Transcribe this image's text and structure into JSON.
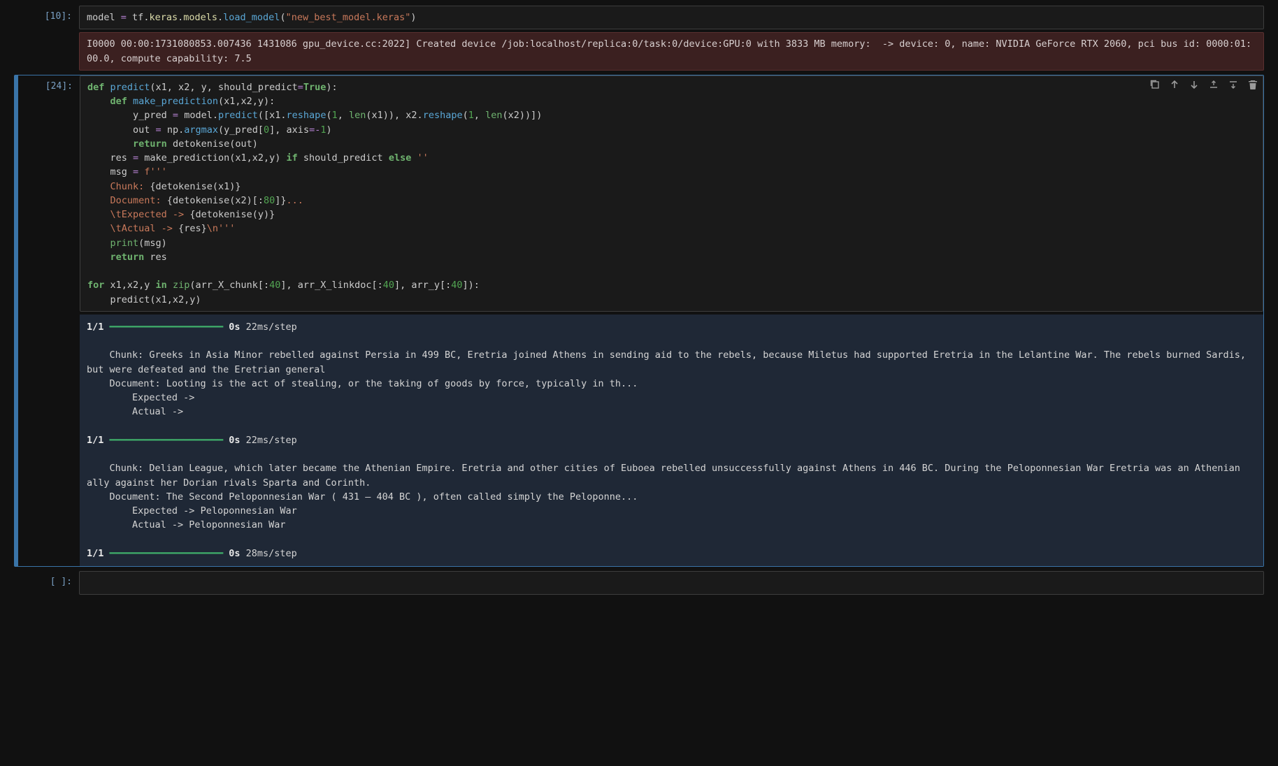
{
  "cells": {
    "c1": {
      "prompt": "[10]:",
      "code_tokens": [
        {
          "t": "model ",
          "c": "id"
        },
        {
          "t": "=",
          "c": "op"
        },
        {
          "t": " tf",
          "c": "id"
        },
        {
          "t": ".",
          "c": "c1"
        },
        {
          "t": "keras",
          "c": "nm"
        },
        {
          "t": ".",
          "c": "c1"
        },
        {
          "t": "models",
          "c": "nm"
        },
        {
          "t": ".",
          "c": "c1"
        },
        {
          "t": "load_model",
          "c": "fn"
        },
        {
          "t": "(",
          "c": "c1"
        },
        {
          "t": "\"new_best_model.keras\"",
          "c": "s"
        },
        {
          "t": ")",
          "c": "c1"
        }
      ],
      "stderr": "I0000 00:00:1731080853.007436 1431086 gpu_device.cc:2022] Created device /job:localhost/replica:0/task:0/device:GPU:0 with 3833 MB memory:  -> device: 0, name: NVIDIA GeForce RTX 2060, pci bus id: 0000:01:00.0, compute capability: 7.5"
    },
    "c2": {
      "prompt": "[24]:",
      "code_lines": [
        [
          {
            "t": "def ",
            "c": "k"
          },
          {
            "t": "predict",
            "c": "fn"
          },
          {
            "t": "(x1, x2, y, should_predict",
            "c": "c1"
          },
          {
            "t": "=",
            "c": "op"
          },
          {
            "t": "True",
            "c": "const"
          },
          {
            "t": "):",
            "c": "c1"
          }
        ],
        [
          {
            "t": "    ",
            "c": "c1"
          },
          {
            "t": "def ",
            "c": "k"
          },
          {
            "t": "make_prediction",
            "c": "fn"
          },
          {
            "t": "(x1,x2,y):",
            "c": "c1"
          }
        ],
        [
          {
            "t": "        y_pred ",
            "c": "c1"
          },
          {
            "t": "=",
            "c": "op"
          },
          {
            "t": " model",
            "c": "c1"
          },
          {
            "t": ".",
            "c": "c1"
          },
          {
            "t": "predict",
            "c": "fn"
          },
          {
            "t": "([x1",
            "c": "c1"
          },
          {
            "t": ".",
            "c": "c1"
          },
          {
            "t": "reshape",
            "c": "fn"
          },
          {
            "t": "(",
            "c": "c1"
          },
          {
            "t": "1",
            "c": "n"
          },
          {
            "t": ", ",
            "c": "c1"
          },
          {
            "t": "len",
            "c": "bu"
          },
          {
            "t": "(x1)), x2",
            "c": "c1"
          },
          {
            "t": ".",
            "c": "c1"
          },
          {
            "t": "reshape",
            "c": "fn"
          },
          {
            "t": "(",
            "c": "c1"
          },
          {
            "t": "1",
            "c": "n"
          },
          {
            "t": ", ",
            "c": "c1"
          },
          {
            "t": "len",
            "c": "bu"
          },
          {
            "t": "(x2))])",
            "c": "c1"
          }
        ],
        [
          {
            "t": "        out ",
            "c": "c1"
          },
          {
            "t": "=",
            "c": "op"
          },
          {
            "t": " np",
            "c": "c1"
          },
          {
            "t": ".",
            "c": "c1"
          },
          {
            "t": "argmax",
            "c": "fn"
          },
          {
            "t": "(y_pred[",
            "c": "c1"
          },
          {
            "t": "0",
            "c": "n"
          },
          {
            "t": "], axis",
            "c": "c1"
          },
          {
            "t": "=-",
            "c": "op"
          },
          {
            "t": "1",
            "c": "n"
          },
          {
            "t": ")",
            "c": "c1"
          }
        ],
        [
          {
            "t": "        ",
            "c": "c1"
          },
          {
            "t": "return",
            "c": "k"
          },
          {
            "t": " detokenise(out)",
            "c": "c1"
          }
        ],
        [
          {
            "t": "    res ",
            "c": "c1"
          },
          {
            "t": "=",
            "c": "op"
          },
          {
            "t": " make_prediction(x1,x2,y) ",
            "c": "c1"
          },
          {
            "t": "if",
            "c": "k"
          },
          {
            "t": " should_predict ",
            "c": "c1"
          },
          {
            "t": "else",
            "c": "k"
          },
          {
            "t": " ",
            "c": "c1"
          },
          {
            "t": "''",
            "c": "s"
          }
        ],
        [
          {
            "t": "    msg ",
            "c": "c1"
          },
          {
            "t": "=",
            "c": "op"
          },
          {
            "t": " ",
            "c": "c1"
          },
          {
            "t": "f'''",
            "c": "s"
          }
        ],
        [
          {
            "t": "    Chunk: ",
            "c": "s"
          },
          {
            "t": "{",
            "c": "c1"
          },
          {
            "t": "detokenise(x1)",
            "c": "c1"
          },
          {
            "t": "}",
            "c": "c1"
          }
        ],
        [
          {
            "t": "    Document: ",
            "c": "s"
          },
          {
            "t": "{",
            "c": "c1"
          },
          {
            "t": "detokenise(x2)[:",
            "c": "c1"
          },
          {
            "t": "80",
            "c": "n"
          },
          {
            "t": "]",
            "c": "c1"
          },
          {
            "t": "}",
            "c": "c1"
          },
          {
            "t": "...",
            "c": "s"
          }
        ],
        [
          {
            "t": "    \\tExpected -> ",
            "c": "s"
          },
          {
            "t": "{",
            "c": "c1"
          },
          {
            "t": "detokenise(y)",
            "c": "c1"
          },
          {
            "t": "}",
            "c": "c1"
          }
        ],
        [
          {
            "t": "    \\tActual -> ",
            "c": "s"
          },
          {
            "t": "{",
            "c": "c1"
          },
          {
            "t": "res",
            "c": "c1"
          },
          {
            "t": "}",
            "c": "c1"
          },
          {
            "t": "\\n'''",
            "c": "s"
          }
        ],
        [
          {
            "t": "    ",
            "c": "c1"
          },
          {
            "t": "print",
            "c": "bu"
          },
          {
            "t": "(msg)",
            "c": "c1"
          }
        ],
        [
          {
            "t": "    ",
            "c": "c1"
          },
          {
            "t": "return",
            "c": "k"
          },
          {
            "t": " res",
            "c": "c1"
          }
        ],
        [
          {
            "t": "",
            "c": "c1"
          }
        ],
        [
          {
            "t": "for",
            "c": "k"
          },
          {
            "t": " x1,x2,y ",
            "c": "c1"
          },
          {
            "t": "in",
            "c": "k"
          },
          {
            "t": " ",
            "c": "c1"
          },
          {
            "t": "zip",
            "c": "bu"
          },
          {
            "t": "(arr_X_chunk[:",
            "c": "c1"
          },
          {
            "t": "40",
            "c": "n"
          },
          {
            "t": "], arr_X_linkdoc[:",
            "c": "c1"
          },
          {
            "t": "40",
            "c": "n"
          },
          {
            "t": "], arr_y[:",
            "c": "c1"
          },
          {
            "t": "40",
            "c": "n"
          },
          {
            "t": "]):",
            "c": "c1"
          }
        ],
        [
          {
            "t": "    predict(x1,x2,y)",
            "c": "c1"
          }
        ]
      ],
      "output_blocks": [
        {
          "progress": {
            "steps": "1/1",
            "bar": "━━━━━━━━━━━━━━━━━━━━",
            "time": "0s",
            "rate": "22ms/step"
          },
          "chunk": "    Chunk: Greeks in Asia Minor rebelled against Persia in 499 BC, Eretria joined Athens in sending aid to the rebels, because Miletus had supported Eretria in the Lelantine War. The rebels burned Sardis, but were defeated and the Eretrian general",
          "document": "    Document: Looting is the act of stealing, or the taking of goods by force, typically in th...",
          "expected": "        Expected -> ",
          "actual": "        Actual -> "
        },
        {
          "progress": {
            "steps": "1/1",
            "bar": "━━━━━━━━━━━━━━━━━━━━",
            "time": "0s",
            "rate": "22ms/step"
          },
          "chunk": "    Chunk: Delian League, which later became the Athenian Empire. Eretria and other cities of Euboea rebelled unsuccessfully against Athens in 446 BC. During the Peloponnesian War Eretria was an Athenian ally against her Dorian rivals Sparta and Corinth.",
          "document": "    Document: The Second Peloponnesian War ( 431 – 404 BC ), often called simply the Peloponne...",
          "expected": "        Expected -> Peloponnesian War",
          "actual": "        Actual -> Peloponnesian War"
        },
        {
          "progress": {
            "steps": "1/1",
            "bar": "━━━━━━━━━━━━━━━━━━━━",
            "time": "0s",
            "rate": "28ms/step"
          }
        }
      ]
    },
    "c3": {
      "prompt": "[ ]:"
    }
  },
  "toolbar_icons": [
    "duplicate",
    "move-up",
    "move-down",
    "insert-above",
    "insert-below",
    "delete"
  ]
}
